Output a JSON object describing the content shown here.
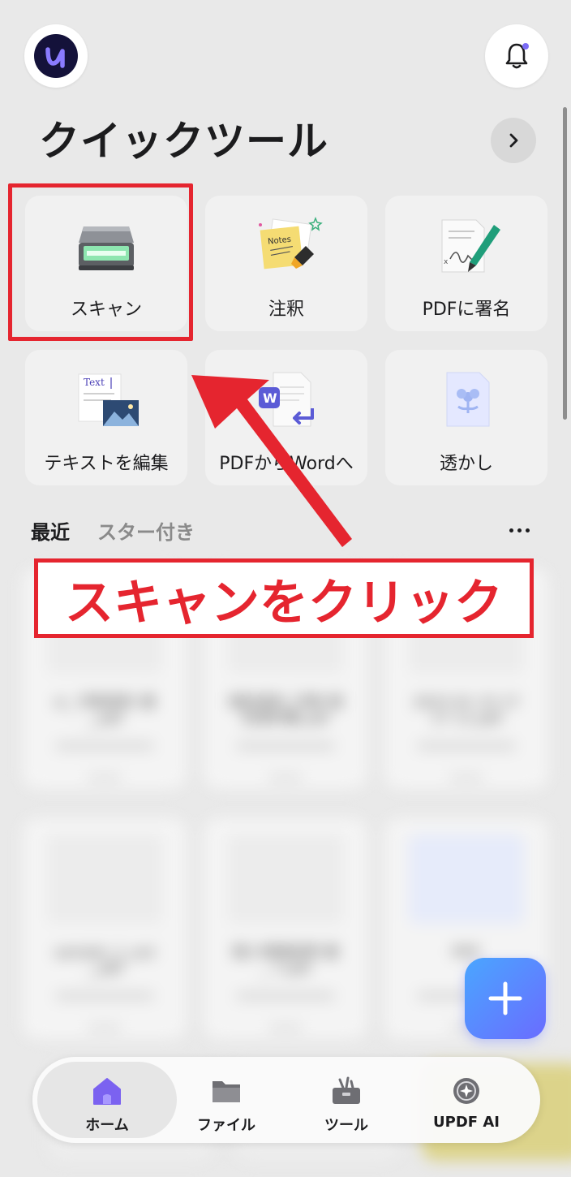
{
  "header": {
    "logo_icon": "updf-logo-icon",
    "bell_icon": "bell-notification-icon",
    "accent": "#7b6cf6"
  },
  "quick_tools": {
    "title": "クイックツール",
    "more_icon": "chevron-right-icon",
    "items": [
      {
        "label": "スキャン",
        "icon": "scanner-icon"
      },
      {
        "label": "注釈",
        "icon": "notes-highlighter-icon"
      },
      {
        "label": "PDFに署名",
        "icon": "pen-signature-icon"
      },
      {
        "label": "テキストを編集",
        "icon": "text-image-edit-icon"
      },
      {
        "label": "PDFからWordへ",
        "icon": "word-convert-icon"
      },
      {
        "label": "透かし",
        "icon": "watermark-icon"
      }
    ]
  },
  "recent": {
    "tab_recent": "最近",
    "tab_starred": "スター付き",
    "more_icon": "ellipsis-icon"
  },
  "files": [
    {
      "name": "xl_ 印刷資料 書 _.pdf"
    },
    {
      "name": "個別資料_印刷 個別資料集.pdf"
    },
    {
      "name": "2023 01 23 17 17 11.pdf"
    },
    {
      "name": "sample_1_out _.pdf"
    },
    {
      "name": "個人情報説明 書 _ 7.pdf"
    },
    {
      "name": "PDF"
    }
  ],
  "fab": {
    "icon": "plus-icon",
    "color": "#5b8cff"
  },
  "bottom_nav": [
    {
      "label": "ホーム",
      "icon": "home-icon",
      "active": true
    },
    {
      "label": "ファイル",
      "icon": "folder-icon",
      "active": false
    },
    {
      "label": "ツール",
      "icon": "toolbox-icon",
      "active": false
    },
    {
      "label": "UPDF AI",
      "icon": "ai-sparkle-icon",
      "active": false
    }
  ],
  "annotation": {
    "text": "スキャンをクリック",
    "color": "#e5252f"
  }
}
